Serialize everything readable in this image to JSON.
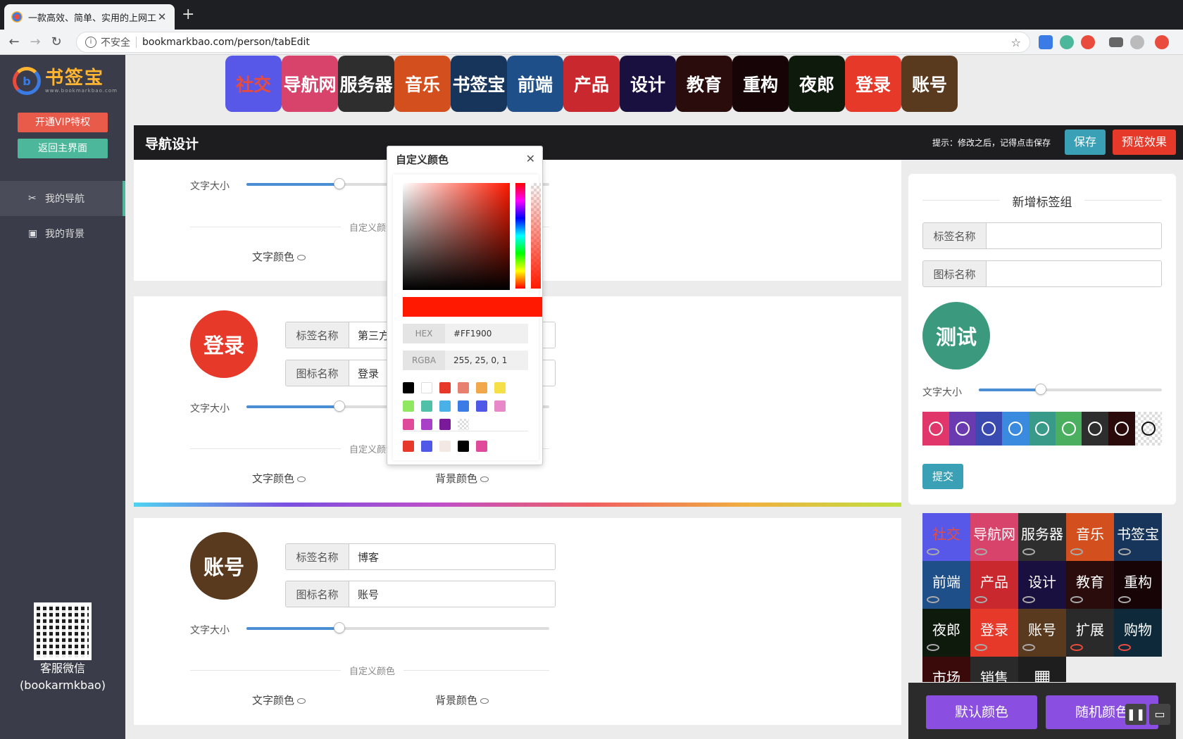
{
  "browser": {
    "tab_title": "一款高效、简单、实用的上网工",
    "url_insecure": "不安全",
    "url": "bookmarkbao.com/person/tabEdit"
  },
  "sidebar": {
    "logo_text": "书签宝",
    "logo_sub": "www.bookmarkbao.com",
    "vip_label": "开通VIP特权",
    "back_label": "返回主界面",
    "nav": [
      {
        "label": "我的导航"
      },
      {
        "label": "我的背景"
      }
    ],
    "qr_label": "客服微信",
    "qr_id": "(bookarmkbao)"
  },
  "top_icons": [
    {
      "label": "社交",
      "bg": "#5858e8",
      "fg": "#e94b3c"
    },
    {
      "label": "导航网",
      "bg": "#d8436c",
      "fg": "#fff"
    },
    {
      "label": "服务器",
      "bg": "#2e2e2e",
      "fg": "#fff"
    },
    {
      "label": "音乐",
      "bg": "#d44f1e",
      "fg": "#fff"
    },
    {
      "label": "书签宝",
      "bg": "#17355a",
      "fg": "#fff"
    },
    {
      "label": "前端",
      "bg": "#1e4f88",
      "fg": "#fff"
    },
    {
      "label": "产品",
      "bg": "#c8282e",
      "fg": "#fff"
    },
    {
      "label": "设计",
      "bg": "#1a1040",
      "fg": "#fff"
    },
    {
      "label": "教育",
      "bg": "#2a0c0c",
      "fg": "#fff"
    },
    {
      "label": "重构",
      "bg": "#160406",
      "fg": "#fff"
    },
    {
      "label": "夜郎",
      "bg": "#0e1a0c",
      "fg": "#fff"
    },
    {
      "label": "登录",
      "bg": "#e6392a",
      "fg": "#fff"
    },
    {
      "label": "账号",
      "bg": "#5a3a1e",
      "fg": "#fff"
    }
  ],
  "header": {
    "title": "导航设计",
    "tip": "提示：修改之后，记得点击保存",
    "save": "保存",
    "preview": "预览效果"
  },
  "labels": {
    "font_size": "文字大小",
    "custom_color": "自定义颜色",
    "text_color": "文字颜色",
    "bg_color": "背景颜色",
    "tag_name": "标签名称",
    "icon_name": "图标名称"
  },
  "cards": [
    {
      "icon": "登录",
      "icon_bg": "#e6392a",
      "tag_value": "第三方",
      "icon_value": "登录"
    },
    {
      "icon": "账号",
      "icon_bg": "#5a3a1e",
      "tag_value": "博客",
      "icon_value": "账号"
    }
  ],
  "picker": {
    "title": "自定义颜色",
    "hex_label": "HEX",
    "hex": "#FF1900",
    "rgba_label": "RGBA",
    "rgba": "255, 25, 0, 1",
    "swatches": [
      "#000000",
      "#ffffff",
      "#e6392a",
      "#e88070",
      "#f0a84a",
      "#f6e048",
      "#90e860",
      "#50c0a8",
      "#4ab0e8",
      "#3b7be6",
      "#5058e8",
      "#e888c8",
      "#e04a9a",
      "#a840c8",
      "#7a1a9a",
      "checker"
    ],
    "recent": [
      "#e6392a",
      "#5058e8",
      "#f4e8e4",
      "#000000",
      "#e04a9a"
    ]
  },
  "right": {
    "title": "新增标签组",
    "tag_name": "标签名称",
    "icon_name": "图标名称",
    "test_icon": "测试",
    "font_size": "文字大小",
    "submit": "提交",
    "color_swatches": [
      "#e0366a",
      "#6a3ab0",
      "#3a4ab0",
      "#3a8ae0",
      "#3a9a8a",
      "#4ab060",
      "#2e2e2e",
      "#2a0a0a",
      "checker"
    ]
  },
  "grid": [
    {
      "label": "社交",
      "bg": "#5858e8",
      "fg": "#e94b3c",
      "off": false
    },
    {
      "label": "导航网",
      "bg": "#d8436c",
      "fg": "#fff",
      "off": false
    },
    {
      "label": "服务器",
      "bg": "#2e2e2e",
      "fg": "#fff",
      "off": false
    },
    {
      "label": "音乐",
      "bg": "#d44f1e",
      "fg": "#fff",
      "off": false
    },
    {
      "label": "书签宝",
      "bg": "#17355a",
      "fg": "#fff",
      "off": false
    },
    {
      "label": "前端",
      "bg": "#1e4f88",
      "fg": "#fff",
      "off": false
    },
    {
      "label": "产品",
      "bg": "#c8282e",
      "fg": "#fff",
      "off": false
    },
    {
      "label": "设计",
      "bg": "#1a1040",
      "fg": "#fff",
      "off": false
    },
    {
      "label": "教育",
      "bg": "#2a0c0c",
      "fg": "#fff",
      "off": false
    },
    {
      "label": "重构",
      "bg": "#160406",
      "fg": "#fff",
      "off": false
    },
    {
      "label": "夜郎",
      "bg": "#0e1a0c",
      "fg": "#fff",
      "off": false
    },
    {
      "label": "登录",
      "bg": "#e6392a",
      "fg": "#fff",
      "off": false
    },
    {
      "label": "账号",
      "bg": "#5a3a1e",
      "fg": "#fff",
      "off": false
    },
    {
      "label": "扩展",
      "bg": "#2a2a2a",
      "fg": "#fff",
      "off": true
    },
    {
      "label": "购物",
      "bg": "#0e2a3a",
      "fg": "#fff",
      "off": true
    },
    {
      "label": "市场",
      "bg": "#3a0a0a",
      "fg": "#fff",
      "off": false
    },
    {
      "label": "销售",
      "bg": "#2a2a2a",
      "fg": "#fff",
      "off": false
    },
    {
      "label": "",
      "bg": "#1e1e1e",
      "fg": "#fff",
      "off": false,
      "apps": true
    }
  ],
  "bottom": {
    "default_color": "默认颜色",
    "random_color": "随机颜色"
  }
}
